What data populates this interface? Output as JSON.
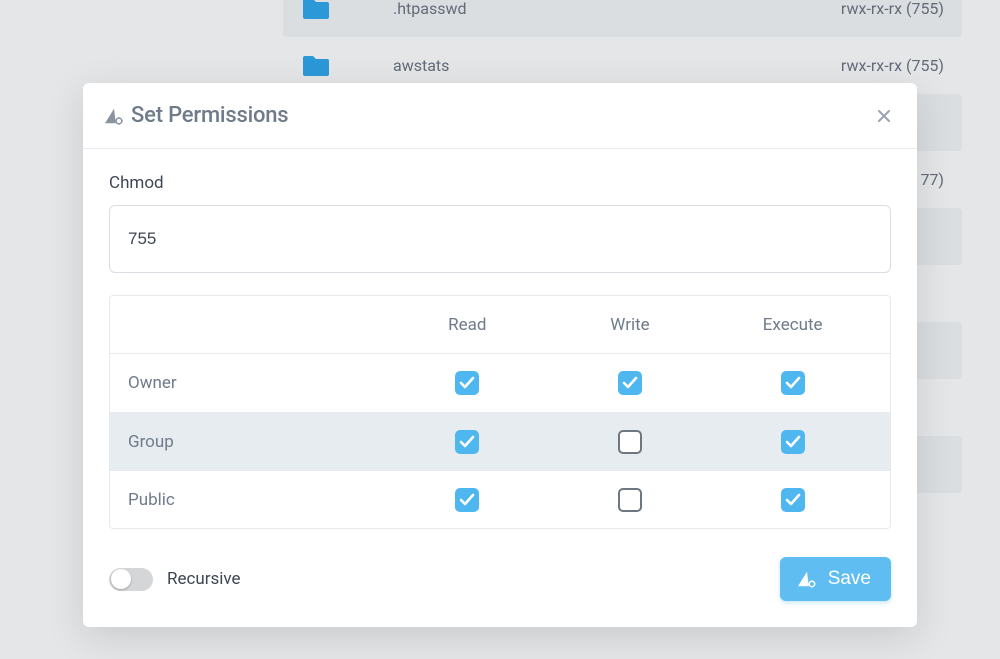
{
  "colors": {
    "accent": "#4fb7f0",
    "folder": "#2ea2e6",
    "text_muted": "#6f7b8a"
  },
  "background_files": [
    {
      "name": ".htpasswd",
      "perm": "rwx-rx-rx (755)",
      "alt": true
    },
    {
      "name": "awstats",
      "perm": "rwx-rx-rx (755)",
      "alt": false
    },
    {
      "name": "",
      "perm": "",
      "alt": true
    },
    {
      "name": "",
      "perm": "77)",
      "alt": false
    },
    {
      "name": "",
      "perm": "",
      "alt": true
    },
    {
      "name": "",
      "perm": "",
      "alt": false
    },
    {
      "name": "",
      "perm": "",
      "alt": true
    },
    {
      "name": "",
      "perm": "",
      "alt": false
    },
    {
      "name": "",
      "perm": "",
      "alt": true
    }
  ],
  "modal": {
    "title": "Set Permissions",
    "chmod_label": "Chmod",
    "chmod_value": "755",
    "columns": [
      "Read",
      "Write",
      "Execute"
    ],
    "rows": [
      {
        "label": "Owner",
        "read": true,
        "write": true,
        "execute": true,
        "striped": false
      },
      {
        "label": "Group",
        "read": true,
        "write": false,
        "execute": true,
        "striped": true
      },
      {
        "label": "Public",
        "read": true,
        "write": false,
        "execute": true,
        "striped": false
      }
    ],
    "recursive_label": "Recursive",
    "recursive_on": false,
    "save_label": "Save"
  }
}
